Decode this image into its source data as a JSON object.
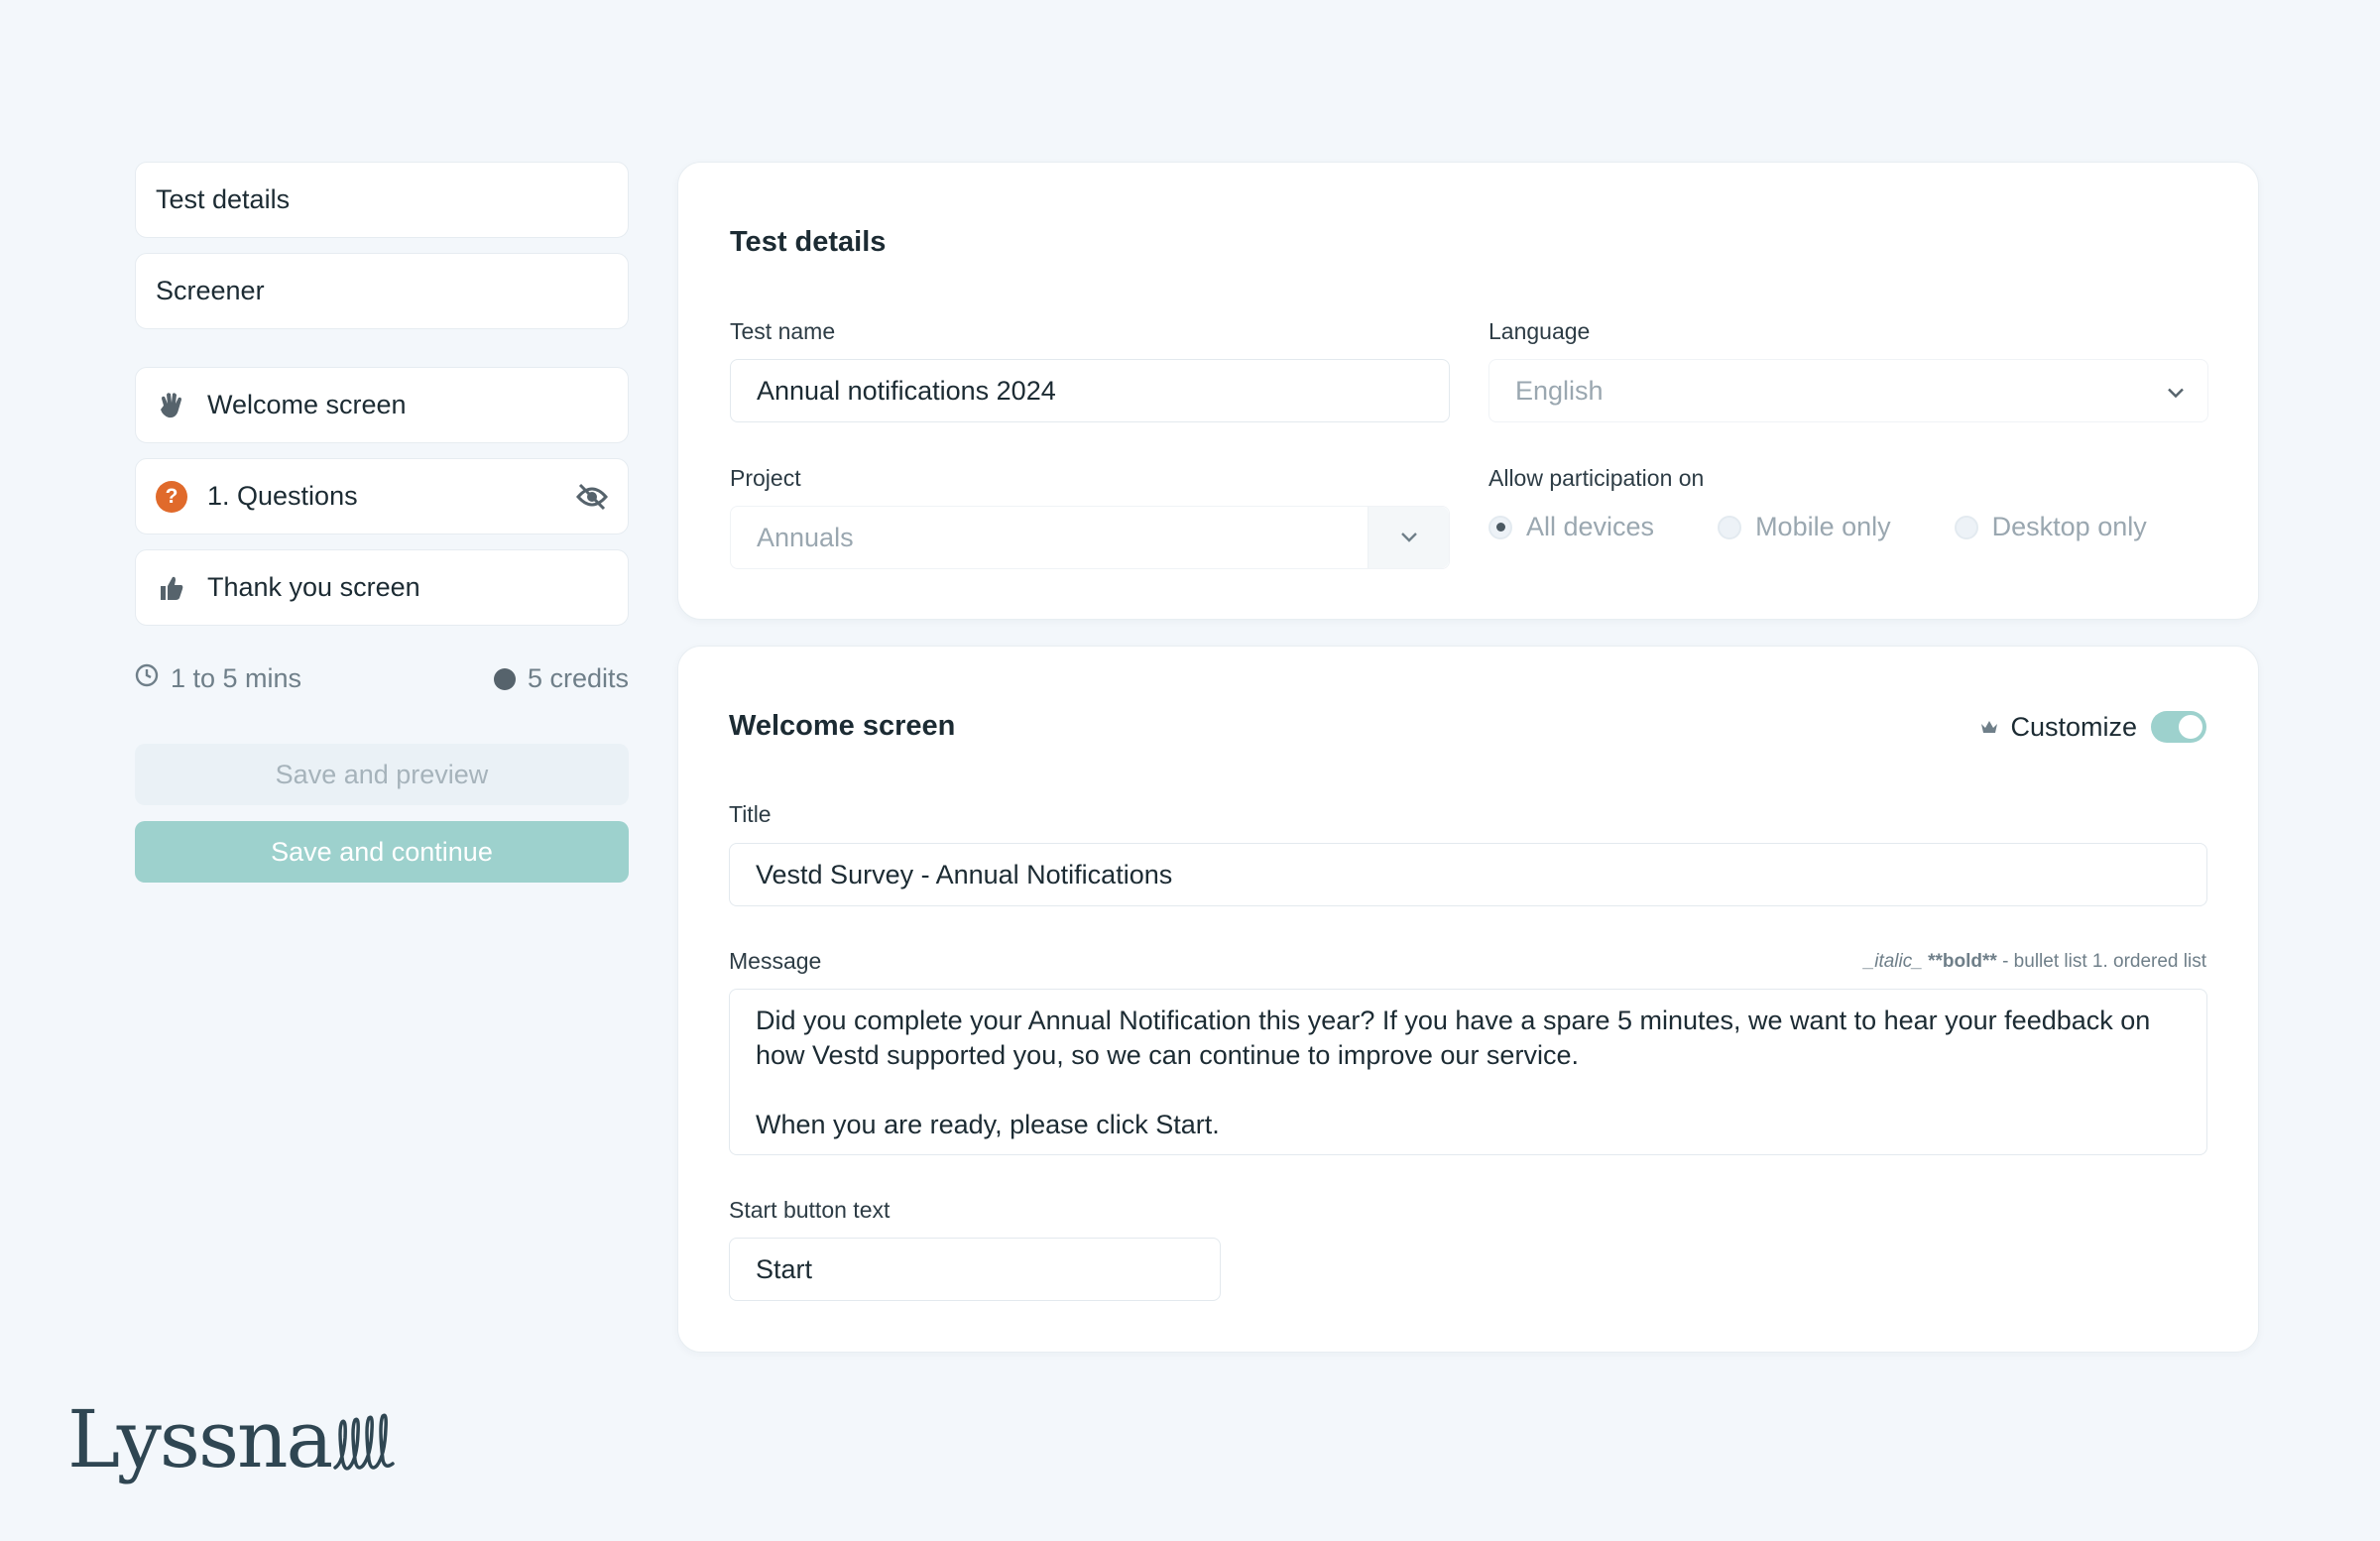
{
  "sidebar": {
    "items": [
      {
        "label": "Test details"
      },
      {
        "label": "Screener"
      },
      {
        "label": "Welcome screen",
        "icon": "wave-hand-icon"
      },
      {
        "label": "1. Questions",
        "icon": "question-badge-icon",
        "badge": "?"
      },
      {
        "label": "Thank you screen",
        "icon": "thumbs-up-icon"
      }
    ],
    "duration": "1 to 5 mins",
    "credits": "5 credits",
    "save_preview_label": "Save and preview",
    "save_continue_label": "Save and continue"
  },
  "test_details": {
    "heading": "Test details",
    "test_name_label": "Test name",
    "test_name_value": "Annual notifications 2024",
    "language_label": "Language",
    "language_value": "English",
    "project_label": "Project",
    "project_value": "Annuals",
    "participation_label": "Allow participation on",
    "participation_options": [
      "All devices",
      "Mobile only",
      "Desktop only"
    ],
    "participation_selected": "All devices"
  },
  "welcome": {
    "heading": "Welcome screen",
    "customize_label": "Customize",
    "customize_on": true,
    "title_label": "Title",
    "title_value": "Vestd Survey - Annual Notifications",
    "message_label": "Message",
    "md_italic": "_italic_",
    "md_bold": "**bold**",
    "md_rest": "- bullet list 1. ordered list",
    "message_value": "Did you complete your Annual Notification this year? If you have a spare 5 minutes, we want to hear your feedback on how Vestd supported you, so we can continue to improve our service.\n\nWhen you are ready, please click Start.",
    "start_label": "Start button text",
    "start_value": "Start"
  },
  "brand": {
    "logo_text": "Lyssna"
  },
  "colors": {
    "accent": "#9dd1cd",
    "question_badge": "#e06a2b",
    "background": "#f3f7fb"
  }
}
